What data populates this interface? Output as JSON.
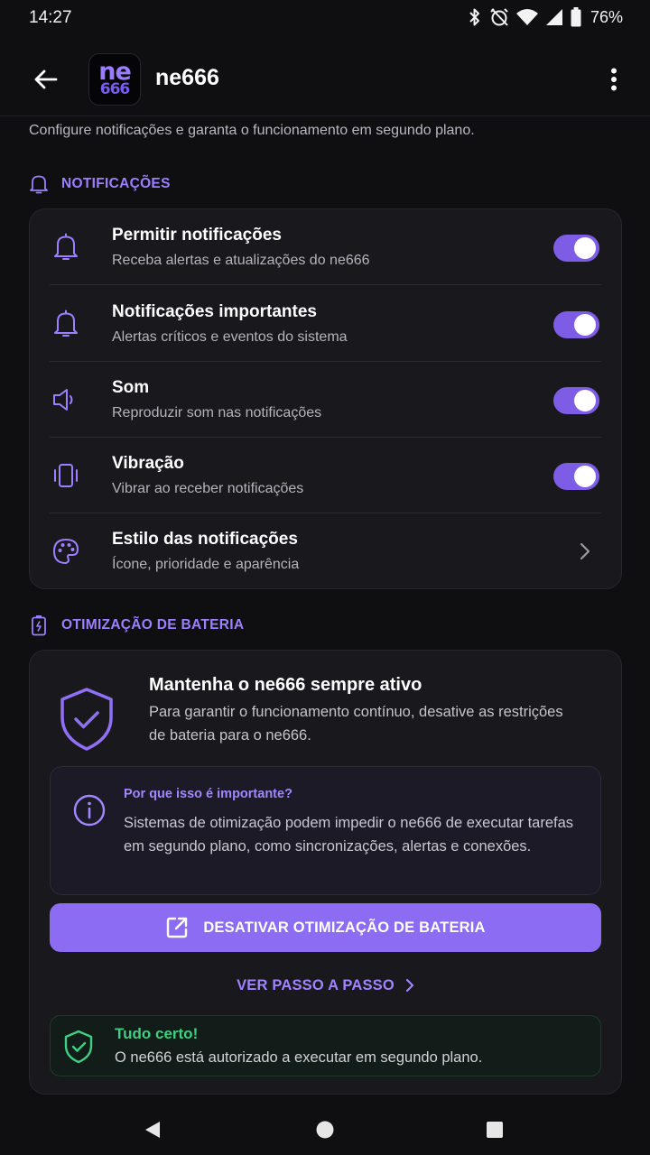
{
  "status_bar": {
    "time": "14:27",
    "battery_percent": "76%",
    "icons": [
      "bluetooth-icon",
      "alarm-off-icon",
      "wifi-icon",
      "signal-icon",
      "battery-icon"
    ]
  },
  "app_bar": {
    "title": "ne666",
    "logo_top": "ne",
    "logo_bottom": "666",
    "back_icon": "arrow-back-icon",
    "more_icon": "more-vert-icon"
  },
  "subtitle": "Configure notificações e garanta o funcionamento em segundo plano.",
  "notifications_section": {
    "header": "NOTIFICAÇÕES",
    "items": [
      {
        "icon": "bell-icon",
        "title": "Permitir notificações",
        "description": "Receba alertas e atualizações do ne666",
        "control": "toggle",
        "enabled": true
      },
      {
        "icon": "bell-icon",
        "title": "Notificações importantes",
        "description": "Alertas críticos e eventos do sistema",
        "control": "toggle",
        "enabled": true
      },
      {
        "icon": "speaker-icon",
        "title": "Som",
        "description": "Reproduzir som nas notificações",
        "control": "toggle",
        "enabled": true
      },
      {
        "icon": "vibration-icon",
        "title": "Vibração",
        "description": "Vibrar ao receber notificações",
        "control": "toggle",
        "enabled": true
      },
      {
        "icon": "palette-icon",
        "title": "Estilo das notificações",
        "description": "Ícone, prioridade e aparência",
        "control": "chevron"
      }
    ]
  },
  "battery_section": {
    "header": "OTIMIZAÇÃO DE BATERIA",
    "title": "Mantenha o ne666 sempre ativo",
    "description": "Para garantir o funcionamento contínuo, desative as restrições de bateria para o ne666.",
    "info": {
      "title": "Por que isso é importante?",
      "text": "Sistemas de otimização podem impedir o ne666 de executar tarefas em segundo plano, como sincronizações, alertas e conexões."
    },
    "primary_button": "DESATIVAR OTIMIZAÇÃO DE BATERIA",
    "link_button": "VER PASSO A PASSO",
    "status": {
      "title": "Tudo certo!",
      "text": "O ne666 está autorizado a executar em segundo plano."
    }
  },
  "colors": {
    "background": "#0f0f12",
    "card": "#18181d",
    "accent": "#8b6cf2",
    "accent_text": "#9d7fff",
    "success": "#3fcf83"
  }
}
